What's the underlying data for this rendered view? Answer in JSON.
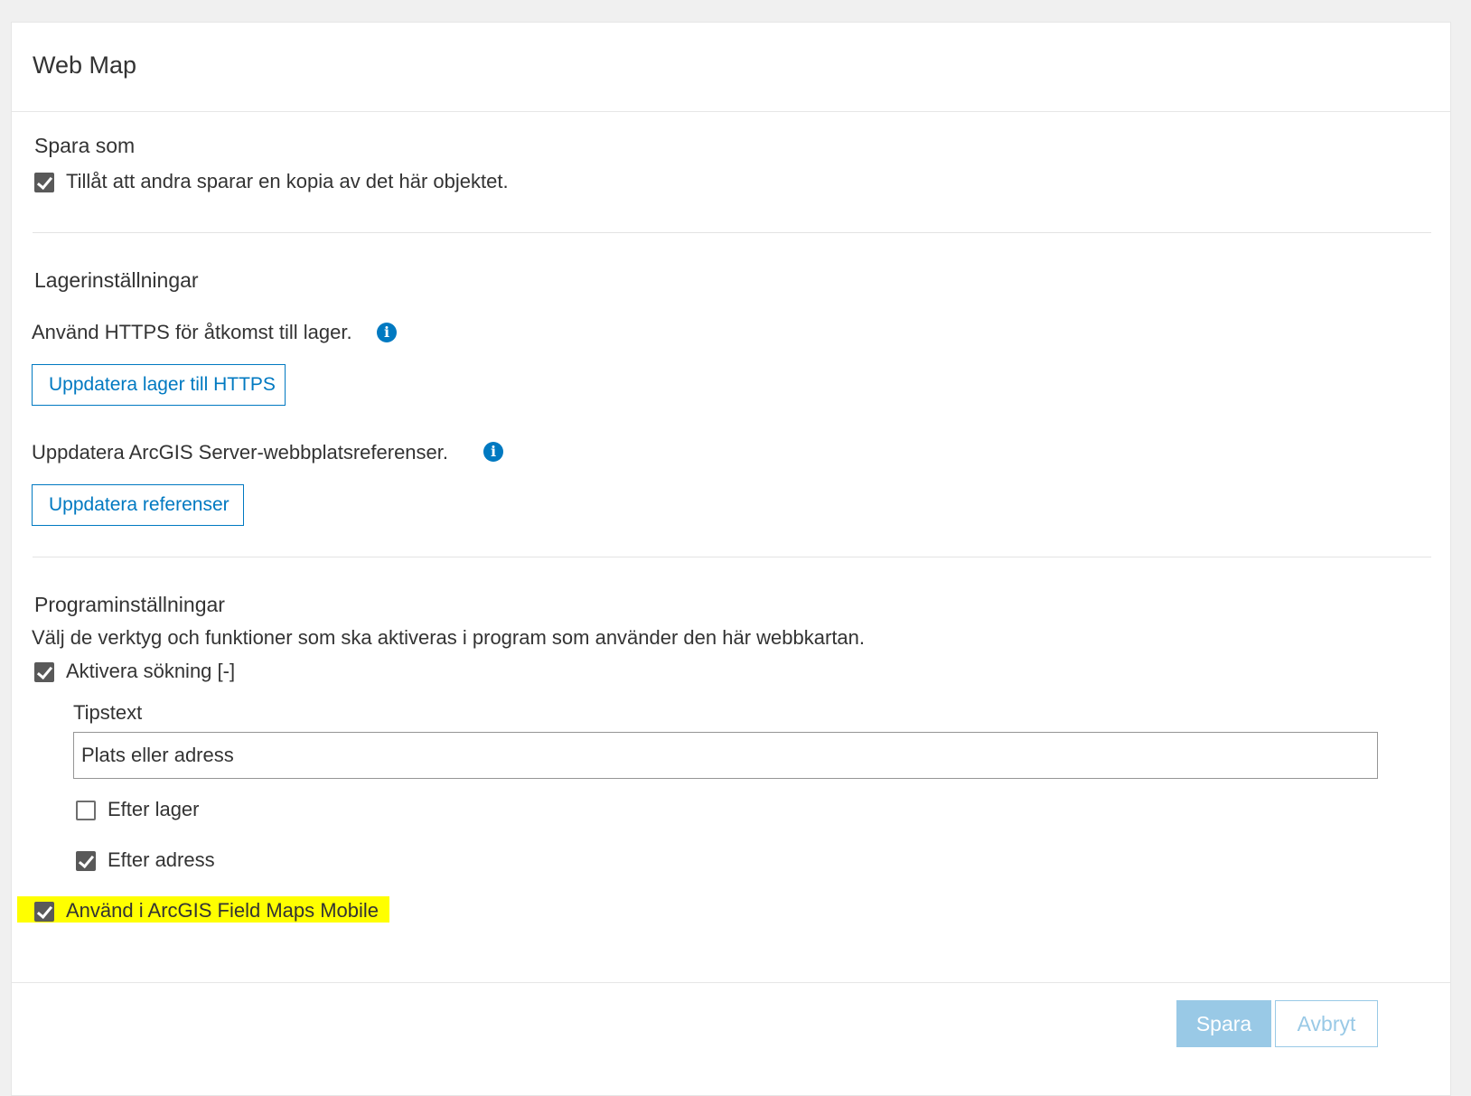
{
  "header": {
    "title": "Web Map"
  },
  "save_as": {
    "title": "Spara som",
    "allow_copy": {
      "label": "Tillåt att andra sparar en kopia av det här objektet.",
      "checked": true
    }
  },
  "layer_settings": {
    "title": "Lagerinställningar",
    "https_text": "Använd HTTPS för åtkomst till lager.",
    "https_button": "Uppdatera lager till HTTPS",
    "server_text": "Uppdatera ArcGIS Server-webbplatsreferenser.",
    "server_button": "Uppdatera referenser"
  },
  "app_settings": {
    "title": "Programinställningar",
    "description": "Välj de verktyg och funktioner som ska aktiveras i program som använder den här webbkartan.",
    "enable_search": {
      "label": "Aktivera sökning",
      "toggle": "[-]",
      "checked": true
    },
    "hint": {
      "label": "Tipstext",
      "value": "Plats eller adress"
    },
    "by_layer": {
      "label": "Efter lager",
      "checked": false
    },
    "by_address": {
      "label": "Efter adress",
      "checked": true
    },
    "field_maps": {
      "label": "Använd i ArcGIS Field Maps Mobile",
      "checked": true,
      "highlight_color": "#ffff00"
    }
  },
  "footer": {
    "save_label": "Spara",
    "cancel_label": "Avbryt"
  },
  "colors": {
    "accent": "#0079c1",
    "primary_disabled": "#99c9e6",
    "checkbox": "#595959"
  }
}
